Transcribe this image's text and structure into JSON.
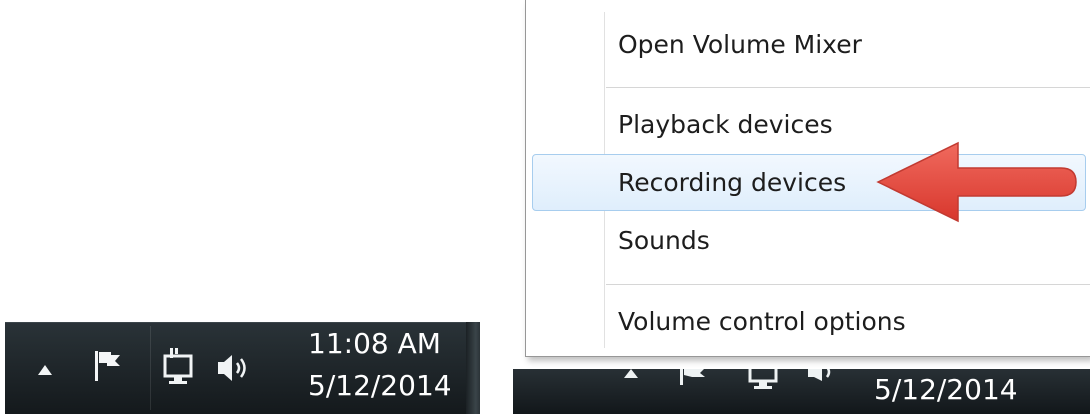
{
  "left_taskbar": {
    "icons": {
      "show_hidden": "up-arrow-icon",
      "action_center": "flag-icon",
      "network": "network-monitor-icon",
      "volume": "speaker-icon"
    },
    "clock_time": "11:08 AM",
    "clock_date": "5/12/2014"
  },
  "context_menu": {
    "items": [
      {
        "label": "Open Volume Mixer"
      },
      {
        "label": "Playback devices"
      },
      {
        "label": "Recording devices",
        "highlighted": true
      },
      {
        "label": "Sounds"
      },
      {
        "label": "Volume control options"
      }
    ],
    "highlight_border_color": "#a7cdee",
    "highlight_fill_color": "#e5f1fd"
  },
  "annotation": {
    "arrow_color": "#e04a3f",
    "arrow_target": "Recording devices"
  },
  "right_taskbar": {
    "clock_date": "5/12/2014"
  }
}
